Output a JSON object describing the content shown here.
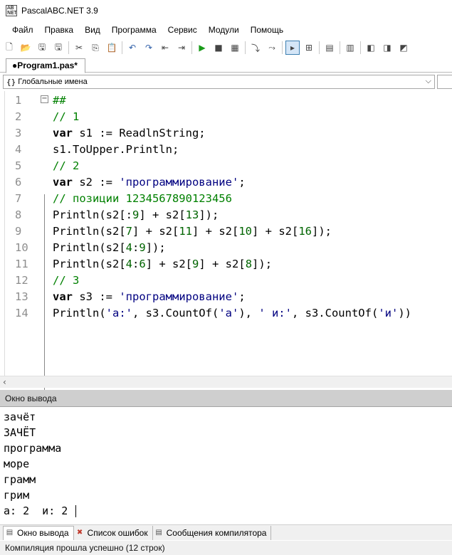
{
  "window": {
    "title": "PascalABC.NET 3.9",
    "icon_text": "AB\nNET"
  },
  "menu": [
    "Файл",
    "Правка",
    "Вид",
    "Программа",
    "Сервис",
    "Модули",
    "Помощь"
  ],
  "toolbar": [
    {
      "icon": "new-file-icon",
      "glyph": "🗋"
    },
    {
      "icon": "open-folder-icon",
      "glyph": "📂"
    },
    {
      "icon": "save-icon",
      "glyph": "🖫"
    },
    {
      "icon": "save-all-icon",
      "glyph": "🖫"
    },
    {
      "sep": true
    },
    {
      "icon": "cut-icon",
      "glyph": "✂"
    },
    {
      "icon": "copy-icon",
      "glyph": "⎘"
    },
    {
      "icon": "paste-icon",
      "glyph": "📋"
    },
    {
      "sep": true
    },
    {
      "icon": "undo-icon",
      "glyph": "↶"
    },
    {
      "icon": "redo-icon",
      "glyph": "↷"
    },
    {
      "icon": "navigate-back-icon",
      "glyph": "⇤"
    },
    {
      "icon": "navigate-forward-icon",
      "glyph": "⇥"
    },
    {
      "sep": true
    },
    {
      "icon": "run-icon",
      "glyph": "▶"
    },
    {
      "icon": "stop-icon",
      "glyph": "■"
    },
    {
      "icon": "breakpoint-icon",
      "glyph": "▦"
    },
    {
      "sep": true
    },
    {
      "icon": "step-into-icon",
      "glyph": "⤵"
    },
    {
      "icon": "step-over-icon",
      "glyph": "⤳"
    },
    {
      "sep": true
    },
    {
      "icon": "console-icon",
      "glyph": "▸",
      "selected": true
    },
    {
      "icon": "format-icon",
      "glyph": "⊞"
    },
    {
      "sep": true
    },
    {
      "icon": "debug-window-icon",
      "glyph": "▤"
    },
    {
      "sep": true
    },
    {
      "icon": "code-templates-icon",
      "glyph": "▥"
    },
    {
      "sep": true
    },
    {
      "icon": "form-designer-icon",
      "glyph": "◧"
    },
    {
      "icon": "compile-icon",
      "glyph": "◨"
    },
    {
      "icon": "build-icon",
      "glyph": "◩"
    }
  ],
  "tab": {
    "label": "●Program1.pas*"
  },
  "scope": {
    "icon": "{}",
    "label": "Глобальные имена"
  },
  "code_lines": [
    {
      "n": "1",
      "parts": [
        {
          "t": "##",
          "c": "cm"
        }
      ]
    },
    {
      "n": "2",
      "parts": [
        {
          "t": "// 1",
          "c": "cm"
        }
      ]
    },
    {
      "n": "3",
      "parts": [
        {
          "t": "var",
          "c": "kw"
        },
        {
          "t": " s1 := ReadlnString;",
          "c": ""
        }
      ]
    },
    {
      "n": "4",
      "parts": [
        {
          "t": "s1.ToUpper.Println;",
          "c": ""
        }
      ]
    },
    {
      "n": "5",
      "parts": [
        {
          "t": "// 2",
          "c": "cm"
        }
      ]
    },
    {
      "n": "6",
      "parts": [
        {
          "t": "var",
          "c": "kw"
        },
        {
          "t": " s2 := ",
          "c": ""
        },
        {
          "t": "'программирование'",
          "c": "st"
        },
        {
          "t": ";",
          "c": ""
        }
      ]
    },
    {
      "n": "7",
      "parts": [
        {
          "t": "// позиции 1234567890123456",
          "c": "cm"
        }
      ]
    },
    {
      "n": "8",
      "parts": [
        {
          "t": "Println(s2[:",
          "c": ""
        },
        {
          "t": "9",
          "c": "nm"
        },
        {
          "t": "] + s2[",
          "c": ""
        },
        {
          "t": "13",
          "c": "nm"
        },
        {
          "t": "]);",
          "c": ""
        }
      ]
    },
    {
      "n": "9",
      "parts": [
        {
          "t": "Println(s2[",
          "c": ""
        },
        {
          "t": "7",
          "c": "nm"
        },
        {
          "t": "] + s2[",
          "c": ""
        },
        {
          "t": "11",
          "c": "nm"
        },
        {
          "t": "] + s2[",
          "c": ""
        },
        {
          "t": "10",
          "c": "nm"
        },
        {
          "t": "] + s2[",
          "c": ""
        },
        {
          "t": "16",
          "c": "nm"
        },
        {
          "t": "]);",
          "c": ""
        }
      ]
    },
    {
      "n": "10",
      "parts": [
        {
          "t": "Println(s2[",
          "c": ""
        },
        {
          "t": "4",
          "c": "nm"
        },
        {
          "t": ":",
          "c": ""
        },
        {
          "t": "9",
          "c": "nm"
        },
        {
          "t": "]);",
          "c": ""
        }
      ]
    },
    {
      "n": "11",
      "parts": [
        {
          "t": "Println(s2[",
          "c": ""
        },
        {
          "t": "4",
          "c": "nm"
        },
        {
          "t": ":",
          "c": ""
        },
        {
          "t": "6",
          "c": "nm"
        },
        {
          "t": "] + s2[",
          "c": ""
        },
        {
          "t": "9",
          "c": "nm"
        },
        {
          "t": "] + s2[",
          "c": ""
        },
        {
          "t": "8",
          "c": "nm"
        },
        {
          "t": "]);",
          "c": ""
        }
      ]
    },
    {
      "n": "12",
      "parts": [
        {
          "t": "// 3",
          "c": "cm"
        }
      ]
    },
    {
      "n": "13",
      "parts": [
        {
          "t": "var",
          "c": "kw"
        },
        {
          "t": " s3 := ",
          "c": ""
        },
        {
          "t": "'программирование'",
          "c": "st"
        },
        {
          "t": ";",
          "c": ""
        }
      ]
    },
    {
      "n": "14",
      "parts": [
        {
          "t": "Println(",
          "c": ""
        },
        {
          "t": "'а:'",
          "c": "st"
        },
        {
          "t": ", s3.CountOf(",
          "c": ""
        },
        {
          "t": "'а'",
          "c": "st"
        },
        {
          "t": "), ",
          "c": ""
        },
        {
          "t": "' и:'",
          "c": "st"
        },
        {
          "t": ", s3.CountOf(",
          "c": ""
        },
        {
          "t": "'и'",
          "c": "st"
        },
        {
          "t": "))",
          "c": ""
        }
      ]
    }
  ],
  "output": {
    "header": "Окно вывода",
    "lines": [
      "зачёт",
      "ЗАЧЁТ",
      "программа",
      "море",
      "грамм",
      "грим",
      "а: 2  и: 2 "
    ]
  },
  "bottom_tabs": [
    {
      "label": "Окно вывода",
      "icon": "output-window-icon",
      "glyph": "▤",
      "active": true
    },
    {
      "label": "Список ошибок",
      "icon": "error-list-icon",
      "glyph": "✖",
      "active": false
    },
    {
      "label": "Сообщения компилятора",
      "icon": "compiler-messages-icon",
      "glyph": "▤",
      "active": false
    }
  ],
  "status": {
    "text": "Компиляция прошла успешно (12 строк)"
  }
}
